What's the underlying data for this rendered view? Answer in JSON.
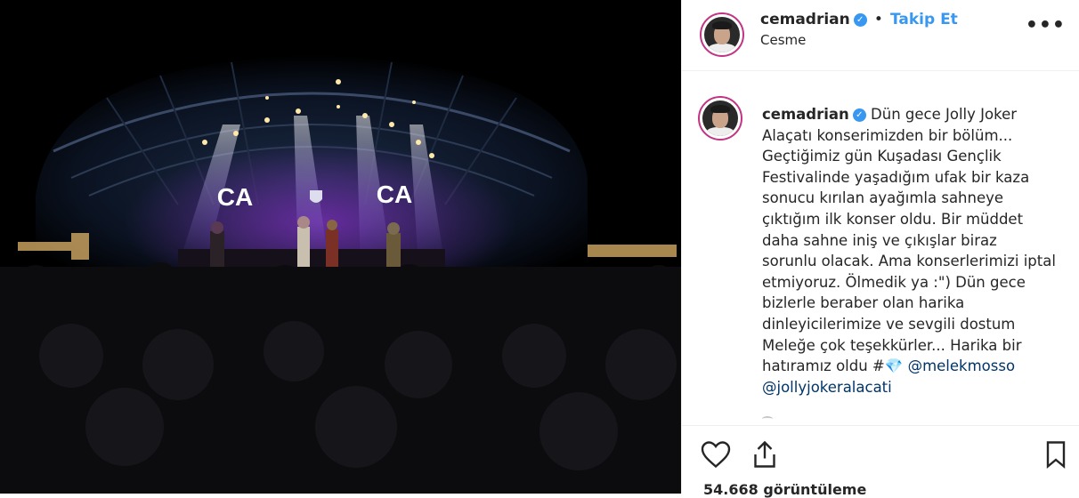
{
  "post": {
    "username": "cemadrian",
    "verified_mark": "✓",
    "separator": "•",
    "follow_label": "Takip Et",
    "location": "Cesme",
    "more_label": "•••"
  },
  "media": {
    "stage_logo_left": "CA",
    "stage_logo_right": "CA"
  },
  "caption": {
    "username": "cemadrian",
    "text": "Dün gece Jolly Joker Alaçatı konserimizden bir bölüm... Geçtiğimiz gün Kuşadası Gençlik Festivalinde yaşadığım ufak bir kaza sonucu kırılan ayağımla sahneye çıktığım ilk konser oldu. Bir müddet daha sahne iniş ve çıkışlar biraz sorunlu olacak. Ama konserlerimizi iptal etmiyoruz. Ölmedik ya :\") Dün gece bizlerle beraber olan harika dinleyicilerimize ve sevgili dostum Meleğe çok teşekkürler... Harika bir hatıramız oldu #",
    "emoji": "💎",
    "mention_1": "@melekmosso",
    "mention_2": "@jollyjokeralacati"
  },
  "actions": {
    "views": "54.668 görüntüleme"
  },
  "icons": {
    "like": "heart-icon",
    "share": "share-icon",
    "save": "bookmark-icon",
    "more": "more-options-icon",
    "verified": "verified-badge-icon"
  },
  "colors": {
    "accent": "#3897f0",
    "mention": "#003569",
    "avatar_ring": "#c13584"
  }
}
